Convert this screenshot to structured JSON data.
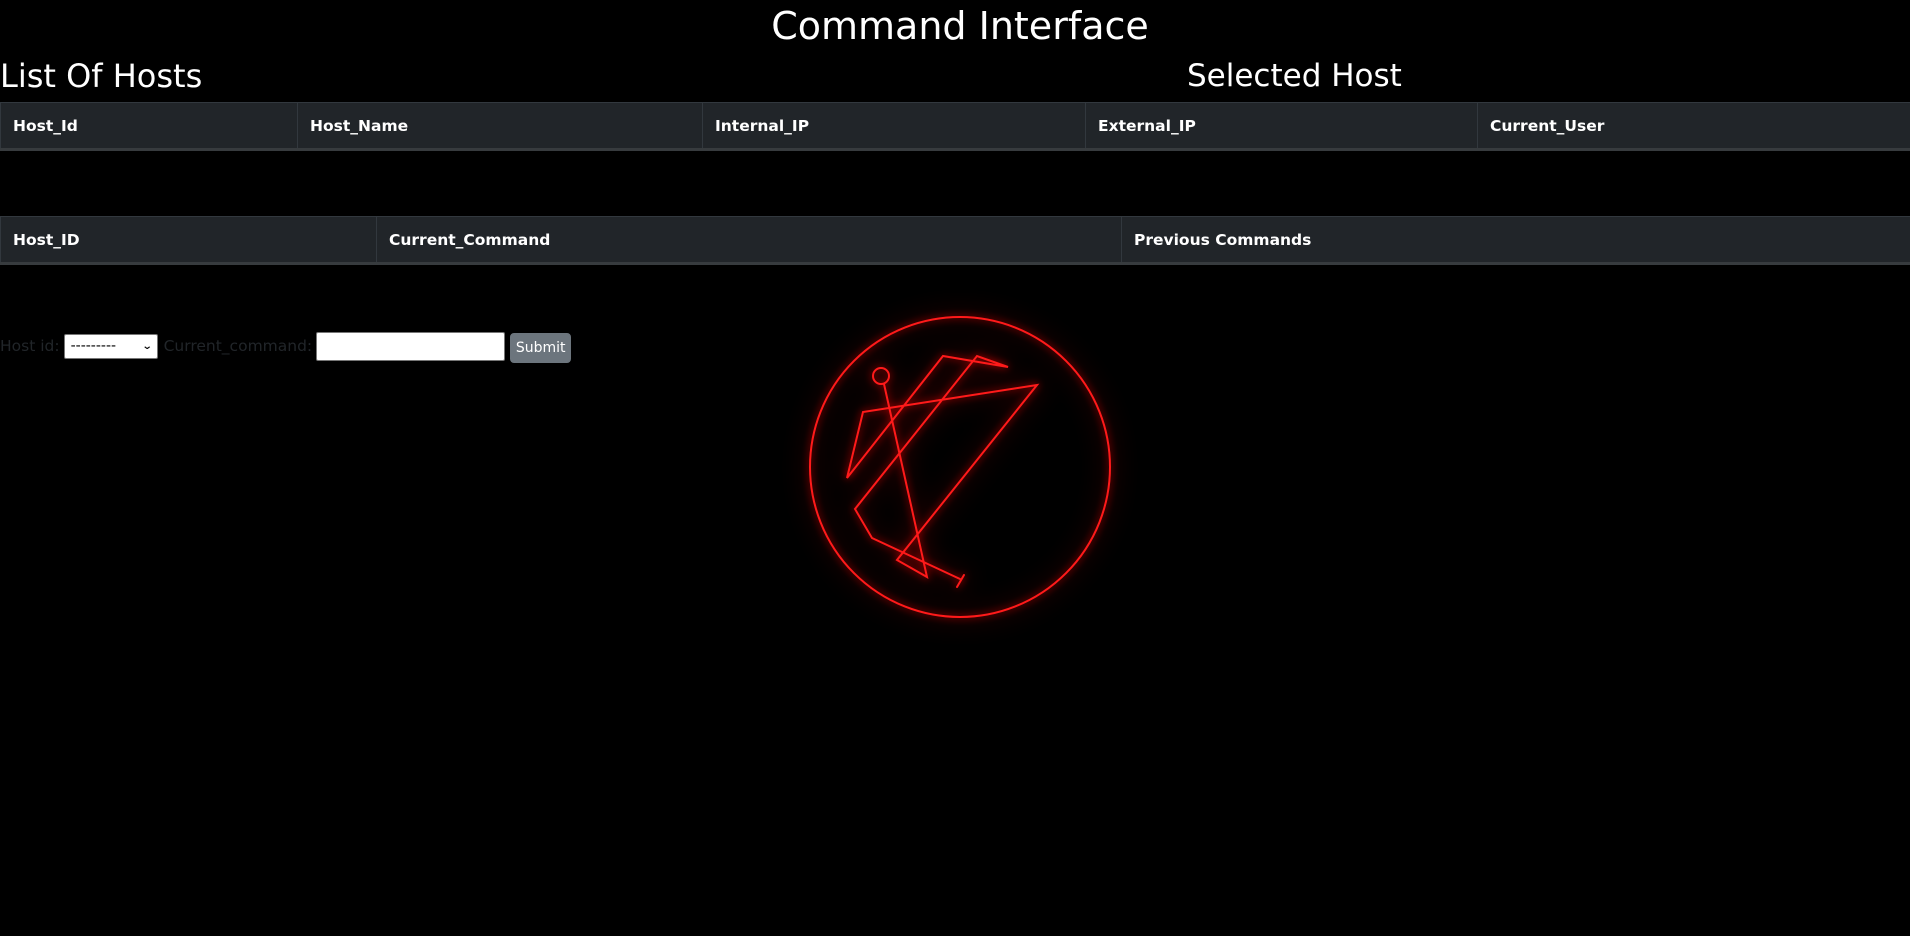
{
  "page": {
    "title": "Command Interface"
  },
  "hosts_section": {
    "heading": "List Of Hosts",
    "columns": [
      "Host_Id",
      "Host_Name",
      "Internal_IP",
      "External_IP",
      "Current_User"
    ],
    "rows": []
  },
  "selected_section": {
    "heading": "Selected Host"
  },
  "commands_table": {
    "columns": [
      "Host_ID",
      "Current_Command",
      "Previous Commands"
    ],
    "rows": []
  },
  "command_form": {
    "host_id_label": "Host id:",
    "host_id_selected": "---------",
    "current_command_label": "Current_command:",
    "current_command_value": "",
    "submit_label": "Submit"
  },
  "logo": {
    "icon": "sigil-icon",
    "color": "#ff1a1a"
  },
  "colors": {
    "background": "#000000",
    "table_header_bg": "#212529",
    "button_bg": "#6c757d"
  }
}
